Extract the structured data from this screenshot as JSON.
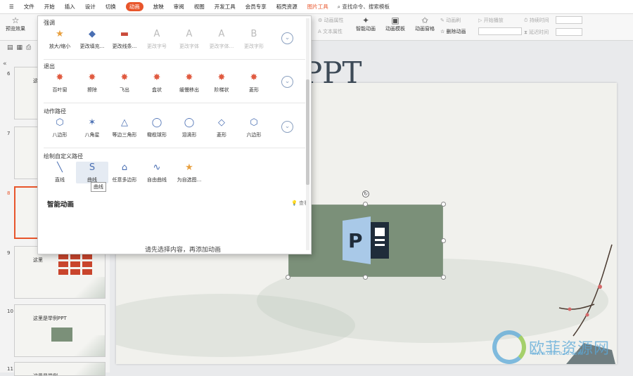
{
  "menubar": {
    "items": [
      {
        "label": "文件",
        "type": "file"
      },
      {
        "label": "开始",
        "type": "normal"
      },
      {
        "label": "插入",
        "type": "normal"
      },
      {
        "label": "设计",
        "type": "normal"
      },
      {
        "label": "切换",
        "type": "normal"
      },
      {
        "label": "动画",
        "type": "active"
      },
      {
        "label": "放映",
        "type": "normal"
      },
      {
        "label": "审阅",
        "type": "normal"
      },
      {
        "label": "视图",
        "type": "normal"
      },
      {
        "label": "开发工具",
        "type": "normal"
      },
      {
        "label": "会员专享",
        "type": "normal"
      },
      {
        "label": "稻壳资源",
        "type": "normal"
      },
      {
        "label": "图片工具",
        "type": "tool"
      }
    ],
    "search_placeholder": "查找命令、搜索模板"
  },
  "ribbon": {
    "preview_label": "预览效果",
    "anim_props": "动画属性",
    "text_props": "文本属性",
    "smart_anim": "智能动画",
    "anim_template": "动画模板",
    "anim_painter": "动画窗格",
    "anim_brush": "动画刷",
    "delete_anim": "删除动画",
    "start_play": "开始播放",
    "duration": "持续时间",
    "delay": "延迟时间"
  },
  "dropdown": {
    "sections": [
      {
        "title": "强调",
        "expand_icon": "chevron-down",
        "items": [
          {
            "label": "放大/缩小",
            "icon": "★",
            "color": "#e8a040",
            "enabled": true
          },
          {
            "label": "更改填充...",
            "icon": "◆",
            "color": "#4a6fb3",
            "enabled": true
          },
          {
            "label": "更改线条...",
            "icon": "▬",
            "color": "#c94a3a",
            "enabled": true
          },
          {
            "label": "更改字号",
            "icon": "A",
            "color": "#bbb",
            "enabled": false
          },
          {
            "label": "更改字体",
            "icon": "A",
            "color": "#bbb",
            "enabled": false
          },
          {
            "label": "更改字体...",
            "icon": "A",
            "color": "#bbb",
            "enabled": false
          },
          {
            "label": "更改字形",
            "icon": "B",
            "color": "#bbb",
            "enabled": false
          }
        ]
      },
      {
        "title": "退出",
        "expand_icon": "chevron-down",
        "items": [
          {
            "label": "百叶窗",
            "icon": "✸",
            "color": "#e05a40",
            "enabled": true
          },
          {
            "label": "擦除",
            "icon": "✸",
            "color": "#e05a40",
            "enabled": true
          },
          {
            "label": "飞出",
            "icon": "✸",
            "color": "#e05a40",
            "enabled": true
          },
          {
            "label": "盒状",
            "icon": "✸",
            "color": "#e05a40",
            "enabled": true
          },
          {
            "label": "缓慢移出",
            "icon": "✸",
            "color": "#e05a40",
            "enabled": true
          },
          {
            "label": "阶梯状",
            "icon": "✸",
            "color": "#e05a40",
            "enabled": true
          },
          {
            "label": "菱形",
            "icon": "✸",
            "color": "#e05a40",
            "enabled": true
          }
        ]
      },
      {
        "title": "动作路径",
        "expand_icon": "chevron-down",
        "items": [
          {
            "label": "八边形",
            "icon": "⬡",
            "color": "#4a6fb3",
            "enabled": true
          },
          {
            "label": "八角星",
            "icon": "✶",
            "color": "#4a6fb3",
            "enabled": true
          },
          {
            "label": "等边三角形",
            "icon": "△",
            "color": "#4a6fb3",
            "enabled": true
          },
          {
            "label": "橄榄球形",
            "icon": "◯",
            "color": "#4a6fb3",
            "enabled": true
          },
          {
            "label": "泪滴形",
            "icon": "◯",
            "color": "#4a6fb3",
            "enabled": true
          },
          {
            "label": "菱形",
            "icon": "◇",
            "color": "#4a6fb3",
            "enabled": true
          },
          {
            "label": "六边形",
            "icon": "⬡",
            "color": "#4a6fb3",
            "enabled": true
          }
        ]
      },
      {
        "title": "绘制自定义路径",
        "items": [
          {
            "label": "直线",
            "icon": "╲",
            "color": "#4a6fb3",
            "enabled": true
          },
          {
            "label": "曲线",
            "icon": "S",
            "color": "#4a6fb3",
            "enabled": true,
            "hover": true
          },
          {
            "label": "任意多边形",
            "icon": "⌂",
            "color": "#4a6fb3",
            "enabled": true
          },
          {
            "label": "自由曲线",
            "icon": "∿",
            "color": "#4a6fb3",
            "enabled": true
          },
          {
            "label": "为自选图...",
            "icon": "★",
            "color": "#e8a040",
            "enabled": true
          }
        ]
      }
    ],
    "tooltip": "曲线",
    "smart_anim_label": "智能动画",
    "view_label": "查看",
    "hint": "请先选择内容，再添加动画"
  },
  "slides": [
    {
      "num": "6",
      "title": "这里是"
    },
    {
      "num": "7",
      "title": ""
    },
    {
      "num": "8",
      "title": "",
      "selected": true
    },
    {
      "num": "9",
      "title": "这里"
    },
    {
      "num": "10",
      "title": "这里是举例PPT"
    },
    {
      "num": "11",
      "title": "这里是举例"
    }
  ],
  "slide": {
    "title": "里是举例PPT"
  },
  "watermark": {
    "text": "欧菲资源网",
    "url": "www.office26.com"
  }
}
